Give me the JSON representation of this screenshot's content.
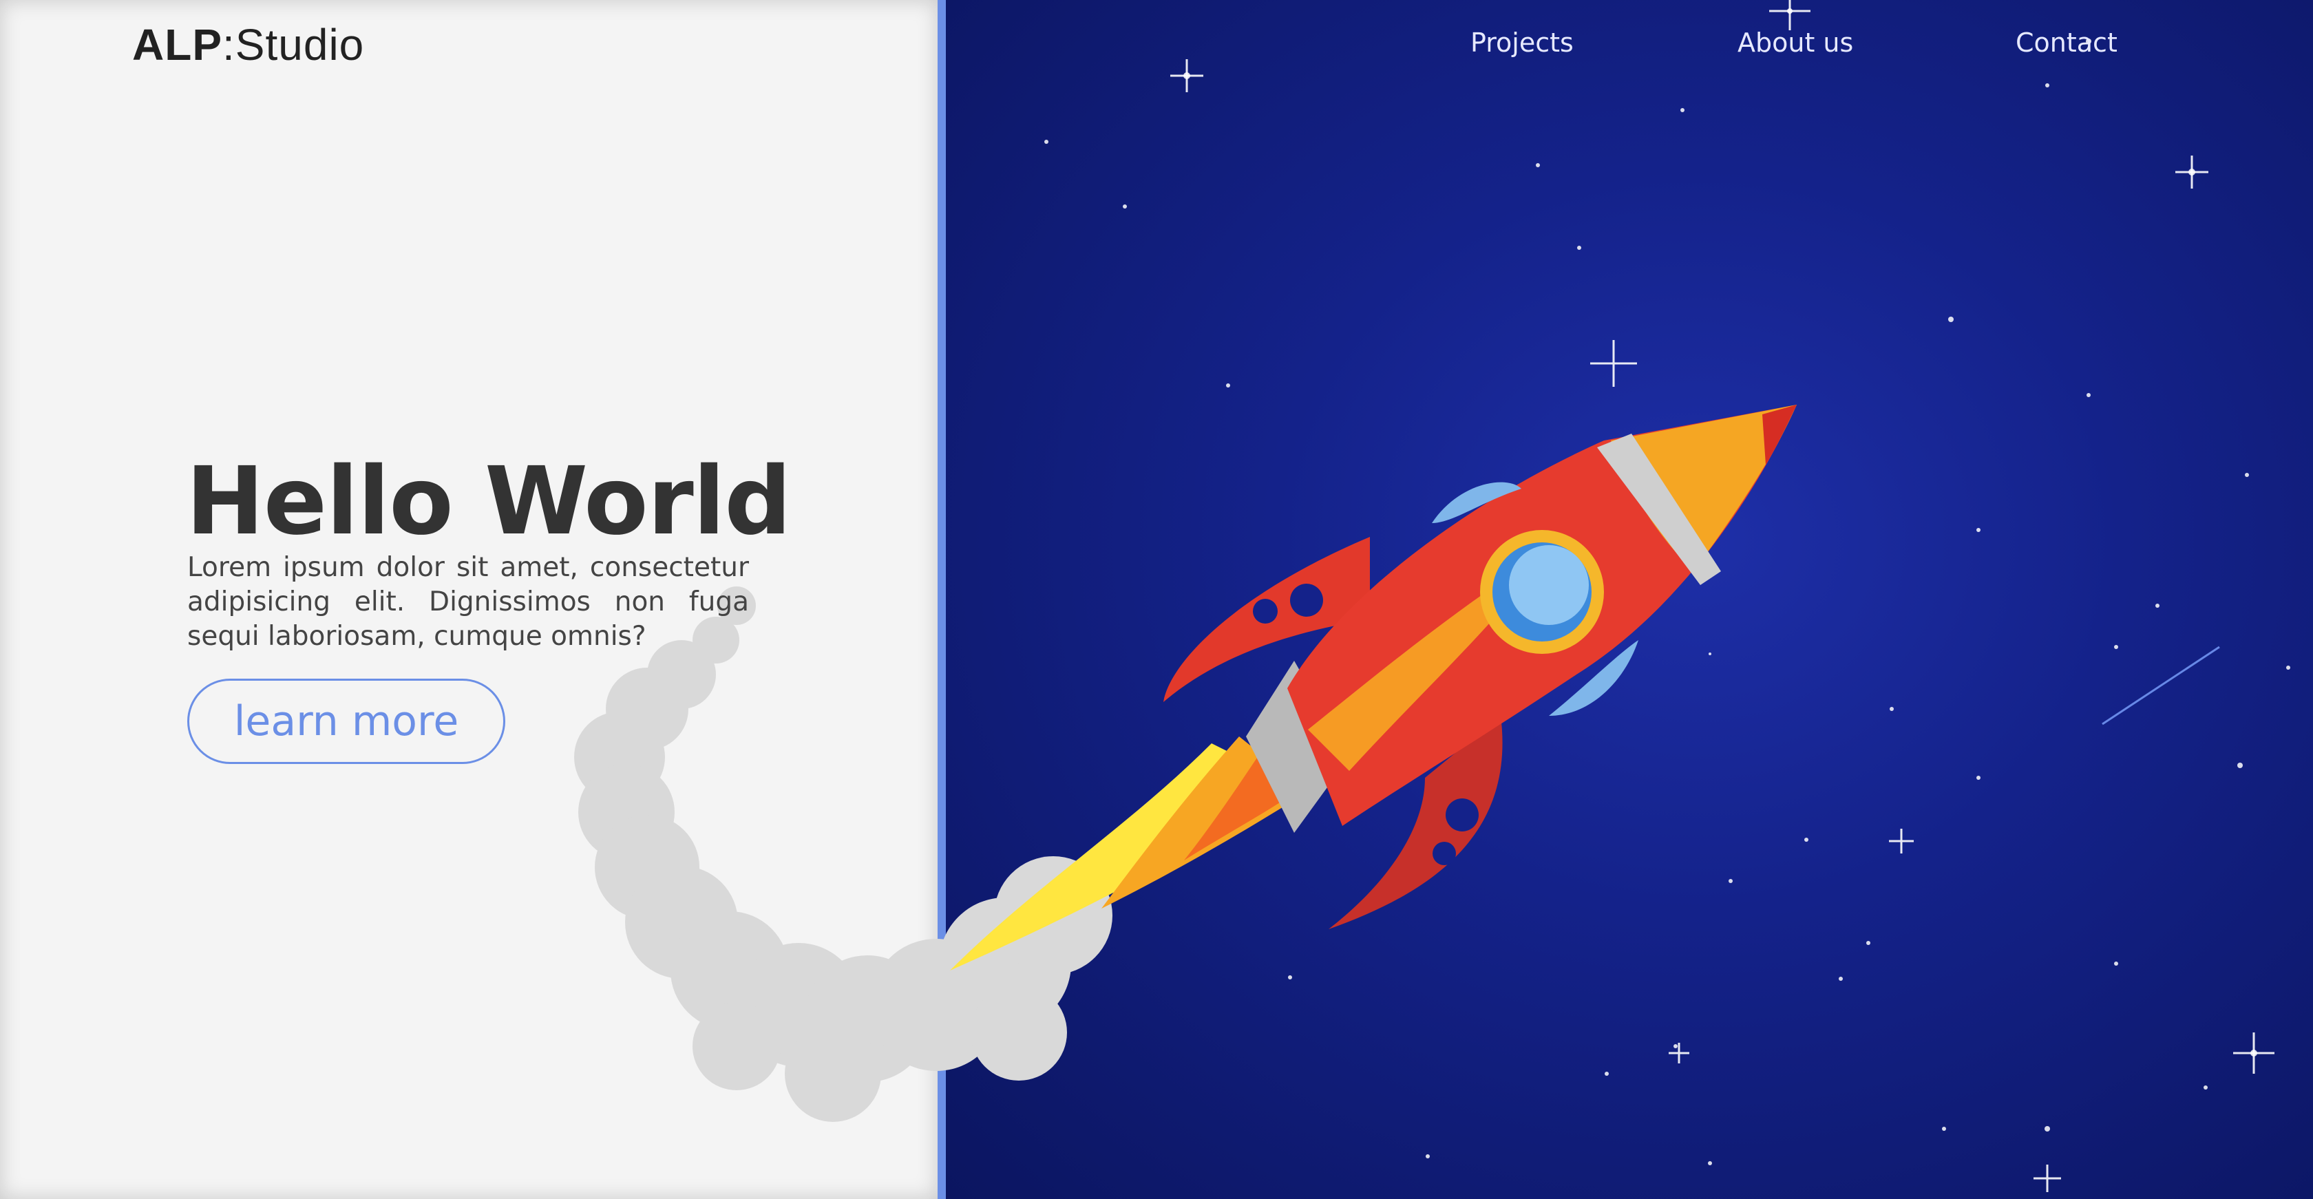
{
  "brand": {
    "bold": "ALP",
    "thin": ":Studio"
  },
  "nav": [
    {
      "label": "Projects"
    },
    {
      "label": "About us"
    },
    {
      "label": "Contact"
    }
  ],
  "hero": {
    "title": "Hello World",
    "text": "Lorem ipsum dolor sit amet, consectetur adipisicing elit. Dignissimos non fuga sequi laboriosam, cumque omnis?",
    "button": "learn more"
  },
  "colors": {
    "accent": "#6b8fe6",
    "panel_bg": "#f4f4f4",
    "space_bg": "#14228a",
    "heading": "#333333"
  },
  "icons": [
    "rocket-illustration",
    "smoke-trail",
    "stars-background"
  ]
}
